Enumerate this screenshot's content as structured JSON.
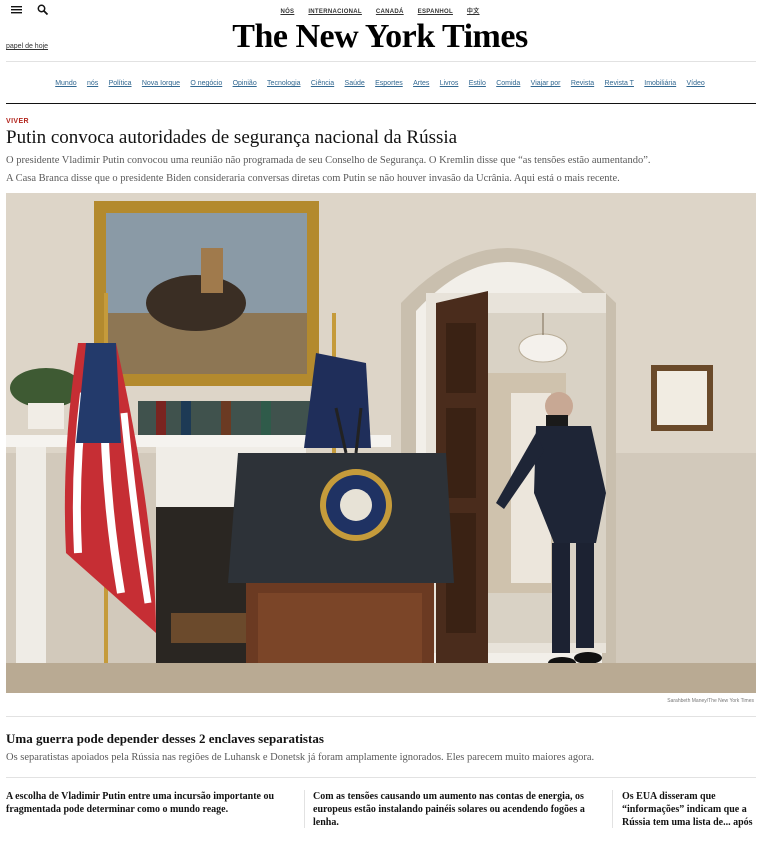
{
  "header": {
    "menu_icon": "hamburger-menu-icon",
    "search_icon": "search-icon",
    "editions": [
      "NÓS",
      "INTERNACIONAL",
      "CANADÁ",
      "ESPANHOL",
      "中文"
    ],
    "logo": "The New York Times",
    "todays_paper": "papel de hoje"
  },
  "nav": [
    "Mundo",
    "nós",
    "Política",
    "Nova Iorque",
    "O negócio",
    "Opinião",
    "Tecnologia",
    "Ciência",
    "Saúde",
    "Esportes",
    "Artes",
    "Livros",
    "Estilo",
    "Comida",
    "Viajar por",
    "Revista",
    "Revista T",
    "Imobiliária",
    "Vídeo"
  ],
  "lead": {
    "kicker": "VIVER",
    "headline": "Putin convoca autoridades de segurança nacional da Rússia",
    "summary_1": "O presidente Vladimir Putin convocou uma reunião não programada de seu Conselho de Segurança. O Kremlin disse que “as tensões estão aumentando”.",
    "summary_2": "A Casa Branca disse que o presidente Biden consideraria conversas diretas com Putin se não houver invasão da Ucrânia. Aqui está o mais recente.",
    "photo_credit": "Sarahbeth Maney/The New York Times"
  },
  "second": {
    "headline": "Uma guerra pode depender desses 2 enclaves separatistas",
    "summary": "Os separatistas apoiados pela Rússia nas regiões de Luhansk e Donetsk já foram amplamente ignorados. Eles parecem muito maiores agora."
  },
  "columns": [
    "A escolha de Vladimir Putin entre uma incursão importante ou fragmentada pode determinar como o mundo reage.",
    "Com as tensões causando um aumento nas contas de energia, os europeus estão instalando painéis solares ou acendendo fogões a lenha.",
    "Os EUA disseram que “informações” indicam que a Rússia tem uma lista de... após uma invasão."
  ]
}
